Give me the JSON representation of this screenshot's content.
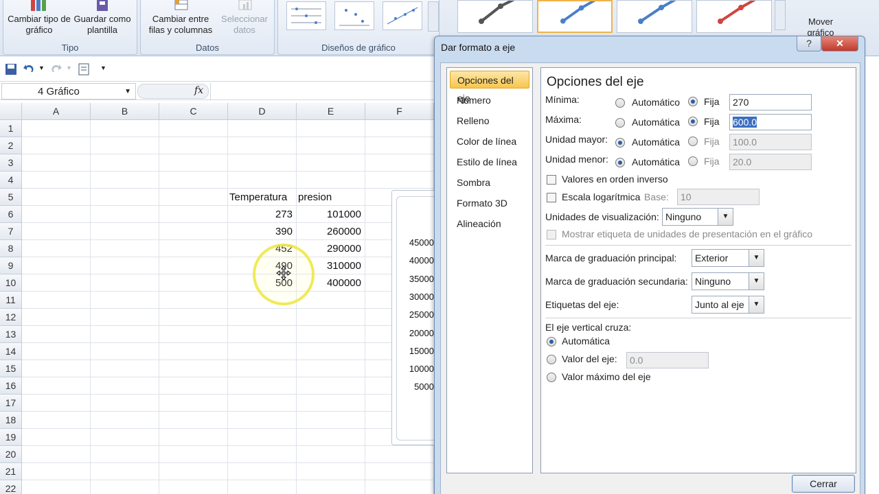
{
  "ribbon": {
    "groups": {
      "tipo": {
        "label": "Tipo",
        "change_type": "Cambiar tipo de gráfico",
        "save_template": "Guardar como plantilla"
      },
      "datos": {
        "label": "Datos",
        "switch_rows": "Cambiar entre filas y columnas",
        "select_data": "Seleccionar datos"
      },
      "disenos": {
        "label": "Diseños de gráfico"
      },
      "mover": {
        "move_chart": "Mover gráfico"
      }
    },
    "style_colors": [
      "#555555",
      "#4a7ec9",
      "#4a7ec9",
      "#d0453f"
    ]
  },
  "formula_bar": {
    "name_box": "4 Gráfico",
    "fx": "fx"
  },
  "sheet": {
    "columns": [
      "A",
      "B",
      "C",
      "D",
      "E",
      "F"
    ],
    "rows": [
      "1",
      "2",
      "3",
      "4",
      "5",
      "6",
      "7",
      "8",
      "9",
      "10",
      "11",
      "12",
      "13",
      "14",
      "15",
      "16",
      "17",
      "18",
      "19",
      "20",
      "21",
      "22"
    ],
    "header_d5": "Temperatura",
    "header_e5": "presion",
    "temperatures": [
      "273",
      "390",
      "452",
      "490",
      "500"
    ],
    "pressures": [
      "101000",
      "260000",
      "290000",
      "310000",
      "400000"
    ]
  },
  "chart_preview": {
    "y_ticks": [
      "45000",
      "40000",
      "35000",
      "30000",
      "25000",
      "20000",
      "15000",
      "10000",
      "5000"
    ]
  },
  "dialog": {
    "title": "Dar formato a eje",
    "help": "?",
    "close": "✕",
    "categories": [
      "Opciones del eje",
      "Número",
      "Relleno",
      "Color de línea",
      "Estilo de línea",
      "Sombra",
      "Formato 3D",
      "Alineación"
    ],
    "selected_category": "Opciones del eje",
    "panel": {
      "title": "Opciones del eje",
      "minimum": {
        "label": "Mínima:",
        "auto": "Automático",
        "fixed": "Fija",
        "value": "270",
        "mode": "Fija"
      },
      "maximum": {
        "label": "Máxima:",
        "auto": "Automática",
        "fixed": "Fija",
        "value": "600.0",
        "mode": "Fija"
      },
      "major_unit": {
        "label": "Unidad mayor:",
        "auto": "Automática",
        "fixed": "Fija",
        "value": "100.0",
        "mode": "Automática"
      },
      "minor_unit": {
        "label": "Unidad menor:",
        "auto": "Automática",
        "fixed": "Fija",
        "value": "20.0",
        "mode": "Automática"
      },
      "reverse_order": "Valores en orden inverso",
      "log_scale": "Escala logarítmica",
      "base_label": "Base:",
      "base_value": "10",
      "display_units_label": "Unidades de visualización:",
      "display_units_value": "Ninguno",
      "show_units_label": "Mostrar etiqueta de unidades de presentación en el gráfico",
      "major_tick_label": "Marca de graduación principal:",
      "major_tick_value": "Exterior",
      "minor_tick_label": "Marca de graduación secundaria:",
      "minor_tick_value": "Ninguno",
      "axis_labels_label": "Etiquetas del eje:",
      "axis_labels_value": "Junto al eje",
      "crosses_header": "El eje vertical cruza:",
      "crosses_auto": "Automática",
      "crosses_value_label": "Valor del eje:",
      "crosses_value": "0.0",
      "crosses_max": "Valor máximo del eje",
      "crosses_mode": "Automática"
    },
    "close_button": "Cerrar"
  }
}
